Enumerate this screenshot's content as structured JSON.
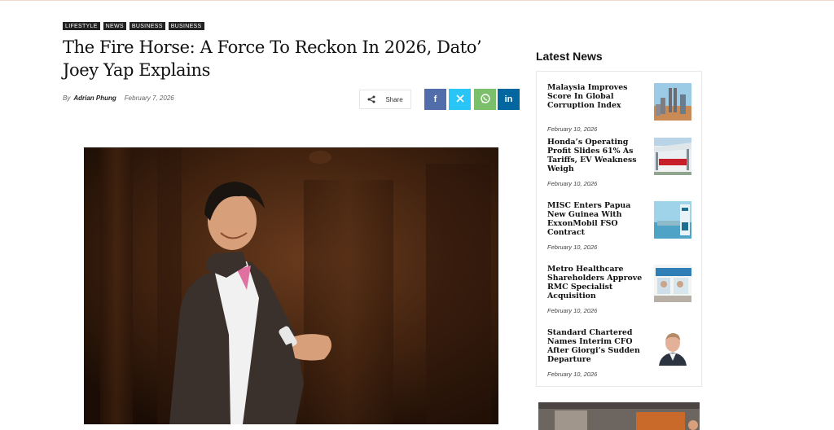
{
  "article": {
    "tags": [
      "LIFESTYLE",
      "NEWS",
      "BUSINESS",
      "BUSINESS"
    ],
    "title": "The Fire Horse: A Force To Reckon In 2026, Dato’ Joey Yap Explains",
    "by_label": "By",
    "author": "Adrian Phung",
    "date": "February 7, 2026",
    "share_label": "Share"
  },
  "social": {
    "facebook_glyph": "f",
    "x_glyph": "𝕏",
    "linkedin_glyph": "in"
  },
  "sidebar": {
    "heading": "Latest News",
    "items": [
      {
        "title": "Malaysia Improves Score In Global Corruption Index",
        "date": "February 10, 2026",
        "thumb_icon": "city-skyline-image"
      },
      {
        "title": "Honda’s Operating Profit Slides 61% As Tariffs, EV Weakness Weigh",
        "date": "February 10, 2026",
        "thumb_icon": "honda-dealership-image"
      },
      {
        "title": "MISC Enters Papua New Guinea With ExxonMobil FSO Contract",
        "date": "February 10, 2026",
        "thumb_icon": "fso-vessel-image"
      },
      {
        "title": "Metro Healthcare Shareholders Approve RMC Specialist Acquisition",
        "date": "February 10, 2026",
        "thumb_icon": "clinic-storefront-image"
      },
      {
        "title": "Standard Chartered Names Interim CFO After Giorgi’s Sudden Departure",
        "date": "February 10, 2026",
        "thumb_icon": "executive-portrait-image"
      }
    ]
  },
  "colors": {
    "facebook": "#516eab",
    "x": "#29c5f6",
    "whatsapp": "#7bbf6a",
    "linkedin": "#0266a0"
  }
}
